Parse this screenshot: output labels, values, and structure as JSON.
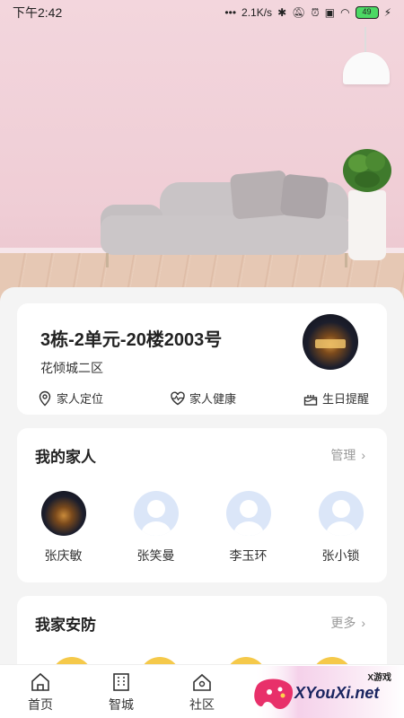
{
  "status_bar": {
    "time": "下午2:42",
    "network_speed": "2.1K/s",
    "battery": "49"
  },
  "house": {
    "title": "3栋-2单元-20楼2003号",
    "community": "花倾城二区",
    "actions": [
      {
        "label": "家人定位",
        "icon": "location-pin-icon"
      },
      {
        "label": "家人健康",
        "icon": "heart-pulse-icon"
      },
      {
        "label": "生日提醒",
        "icon": "birthday-cake-icon"
      }
    ]
  },
  "family": {
    "title": "我的家人",
    "more_label": "管理",
    "members": [
      {
        "name": "张庆敏",
        "avatar": "photo"
      },
      {
        "name": "张笑曼",
        "avatar": "default"
      },
      {
        "name": "李玉环",
        "avatar": "default"
      },
      {
        "name": "张小锁",
        "avatar": "default"
      }
    ]
  },
  "security": {
    "title": "我家安防",
    "more_label": "更多"
  },
  "bottom_nav": [
    {
      "label": "首页",
      "icon": "home-icon"
    },
    {
      "label": "智城",
      "icon": "city-building-icon"
    },
    {
      "label": "社区",
      "icon": "community-house-icon"
    }
  ],
  "watermark": {
    "tag": "X游戏",
    "site": "XYouXi.net"
  },
  "colors": {
    "accent_yellow": "#f5c94a",
    "avatar_default": "#dbe6f8",
    "muted_text": "#999999"
  }
}
